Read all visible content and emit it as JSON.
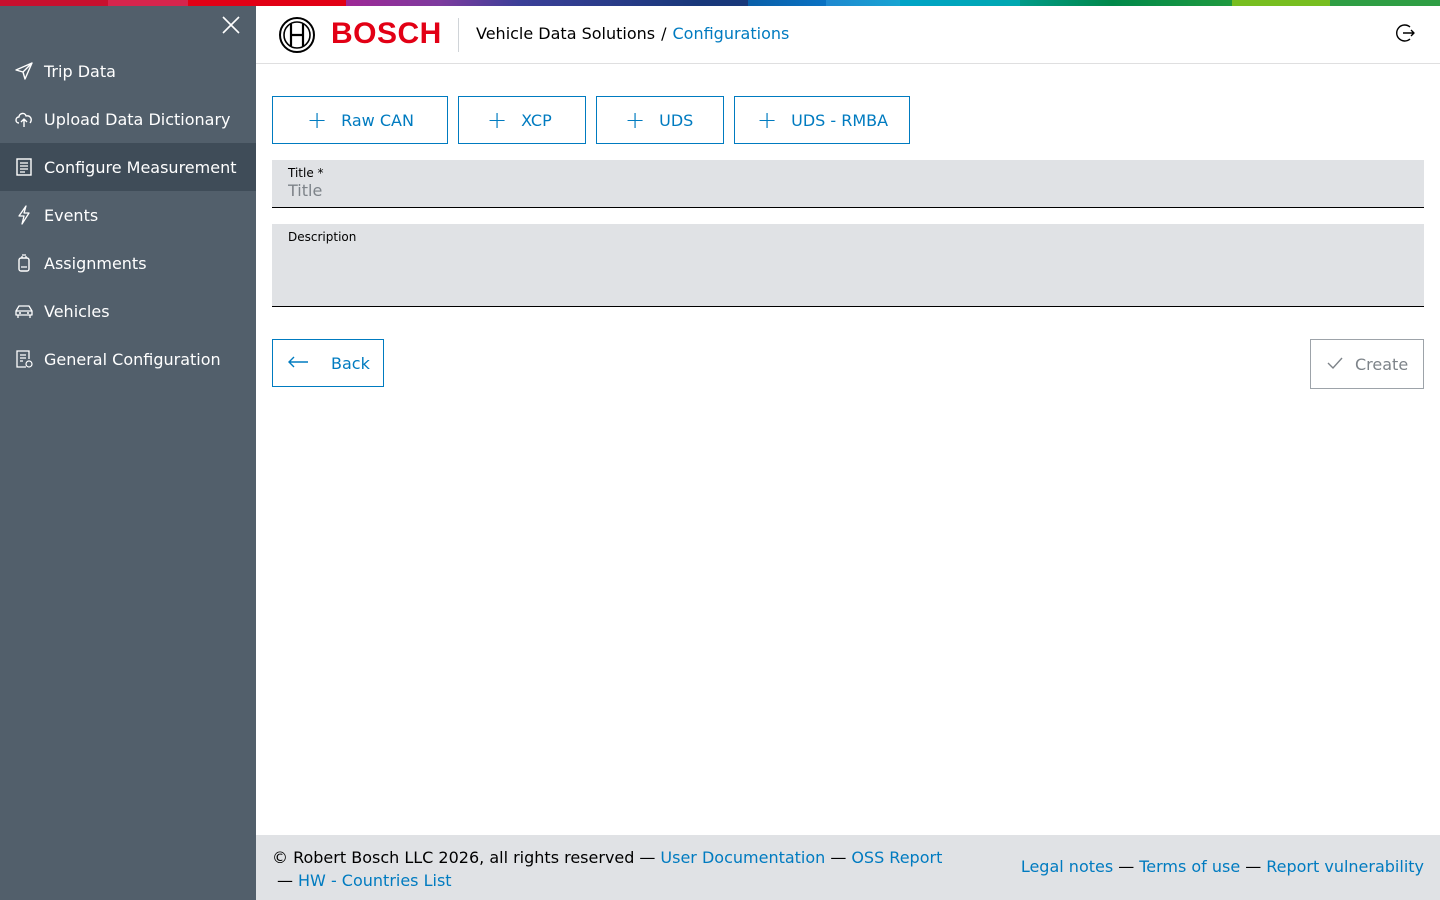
{
  "sidebar": {
    "close_icon": "close-icon",
    "items": [
      {
        "label": "Trip Data",
        "icon": "paper-plane-icon"
      },
      {
        "label": "Upload Data Dictionary",
        "icon": "cloud-upload-icon"
      },
      {
        "label": "Configure Measurement",
        "icon": "clipboard-icon",
        "active": true
      },
      {
        "label": "Events",
        "icon": "lightning-icon"
      },
      {
        "label": "Assignments",
        "icon": "device-icon"
      },
      {
        "label": "Vehicles",
        "icon": "car-icon"
      },
      {
        "label": "General Configuration",
        "icon": "settings-document-icon"
      }
    ]
  },
  "header": {
    "logo_text": "BOSCH",
    "breadcrumb_root": "Vehicle Data Solutions",
    "breadcrumb_sep": "/",
    "breadcrumb_current": "Configurations"
  },
  "toolbar": {
    "buttons": [
      {
        "label": "Raw CAN"
      },
      {
        "label": "XCP"
      },
      {
        "label": "UDS"
      },
      {
        "label": "UDS - RMBA"
      }
    ]
  },
  "form": {
    "title_label": "Title *",
    "title_placeholder": "Title",
    "title_value": "",
    "description_label": "Description",
    "description_value": ""
  },
  "actions": {
    "back_label": "Back",
    "create_label": "Create"
  },
  "footer": {
    "copyright": "© Robert Bosch LLC 2026, all rights reserved",
    "sep": "—",
    "user_docs": "User Documentation",
    "oss_report": "OSS Report",
    "hw_countries": "HW - Countries List",
    "legal_notes": "Legal notes",
    "terms": "Terms of use",
    "report_vuln": "Report vulnerability"
  },
  "colors": {
    "brand_red": "#e20015",
    "link_blue": "#007bc0",
    "sidebar_bg": "#525f6b",
    "sidebar_active": "#3f4c58",
    "field_bg": "#e0e2e5"
  }
}
